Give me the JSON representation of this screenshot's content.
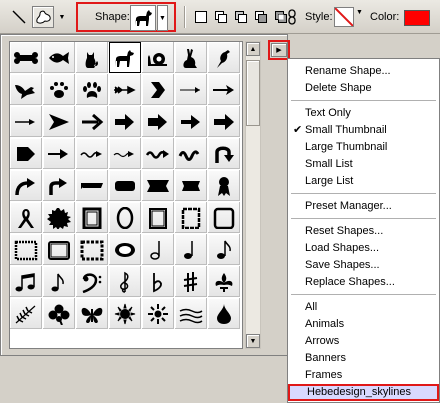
{
  "toolbar": {
    "shape_label": "Shape:",
    "style_label": "Style:",
    "color_label": "Color:",
    "color_value": "#ff0000",
    "icons": [
      "line-tool-icon",
      "custom-shape-tool-icon",
      "shape-dropdown-arrow-icon",
      "new-shape-layer-icon",
      "add-to-area-icon",
      "subtract-area-icon",
      "intersect-area-icon",
      "exclude-area-icon",
      "link-icon",
      "style-none-icon"
    ]
  },
  "picker": {
    "selected_shape": "dog",
    "shapes": [
      "bone",
      "fish",
      "cat",
      "dog",
      "snail",
      "rabbit",
      "bird",
      "dove",
      "paw-print-1",
      "paw-print-2",
      "arrow-feather",
      "arrow-chevron",
      "arrow-thin",
      "arrow-dart",
      "arrow-simple-1",
      "arrow-bold-triangle",
      "arrow-bold-1",
      "arrow-bold-2",
      "arrow-bold-3",
      "arrow-bold-4",
      "arrow-bold-5",
      "arrow-pentagon",
      "arrow-bold-6",
      "arrow-wavy-1",
      "arrow-wavy-2",
      "arrow-wavy-3",
      "arrow-wavy-4",
      "arrow-uturn",
      "arrow-curved-1",
      "arrow-curved-2",
      "banner-1",
      "banner-2",
      "banner-3",
      "banner-4",
      "ribbon",
      "ribbon-awareness",
      "seal",
      "frame-1",
      "frame-oval",
      "frame-2",
      "frame-3",
      "frame-4",
      "frame-5",
      "frame-6",
      "frame-7",
      "frame-ellipse",
      "note-half",
      "note-quarter",
      "note-eighth",
      "notes-beamed",
      "notes-pair",
      "bass-clef",
      "treble-clef",
      "flat",
      "sharp",
      "fleur",
      "fern",
      "shamrock",
      "butterfly",
      "sun-1",
      "sun-2",
      "grass",
      "raindrop"
    ]
  },
  "menu": {
    "items": [
      {
        "label": "Rename Shape...",
        "checked": false
      },
      {
        "label": "Delete Shape",
        "checked": false
      },
      {
        "label": "Text Only",
        "checked": false
      },
      {
        "label": "Small Thumbnail",
        "checked": true
      },
      {
        "label": "Large Thumbnail",
        "checked": false
      },
      {
        "label": "Small List",
        "checked": false
      },
      {
        "label": "Large List",
        "checked": false
      },
      {
        "label": "Preset Manager...",
        "checked": false
      },
      {
        "label": "Reset Shapes...",
        "checked": false
      },
      {
        "label": "Load Shapes...",
        "checked": false
      },
      {
        "label": "Save Shapes...",
        "checked": false
      },
      {
        "label": "Replace Shapes...",
        "checked": false
      },
      {
        "label": "All",
        "checked": false
      },
      {
        "label": "Animals",
        "checked": false
      },
      {
        "label": "Arrows",
        "checked": false
      },
      {
        "label": "Banners",
        "checked": false
      },
      {
        "label": "Frames",
        "checked": false
      },
      {
        "label": "Hebedesign_skylines",
        "checked": false,
        "highlighted": true
      }
    ],
    "check_glyph": "✔"
  },
  "colors": {
    "highlight_border": "#e01818",
    "panel_bg": "#d4d0c8"
  }
}
